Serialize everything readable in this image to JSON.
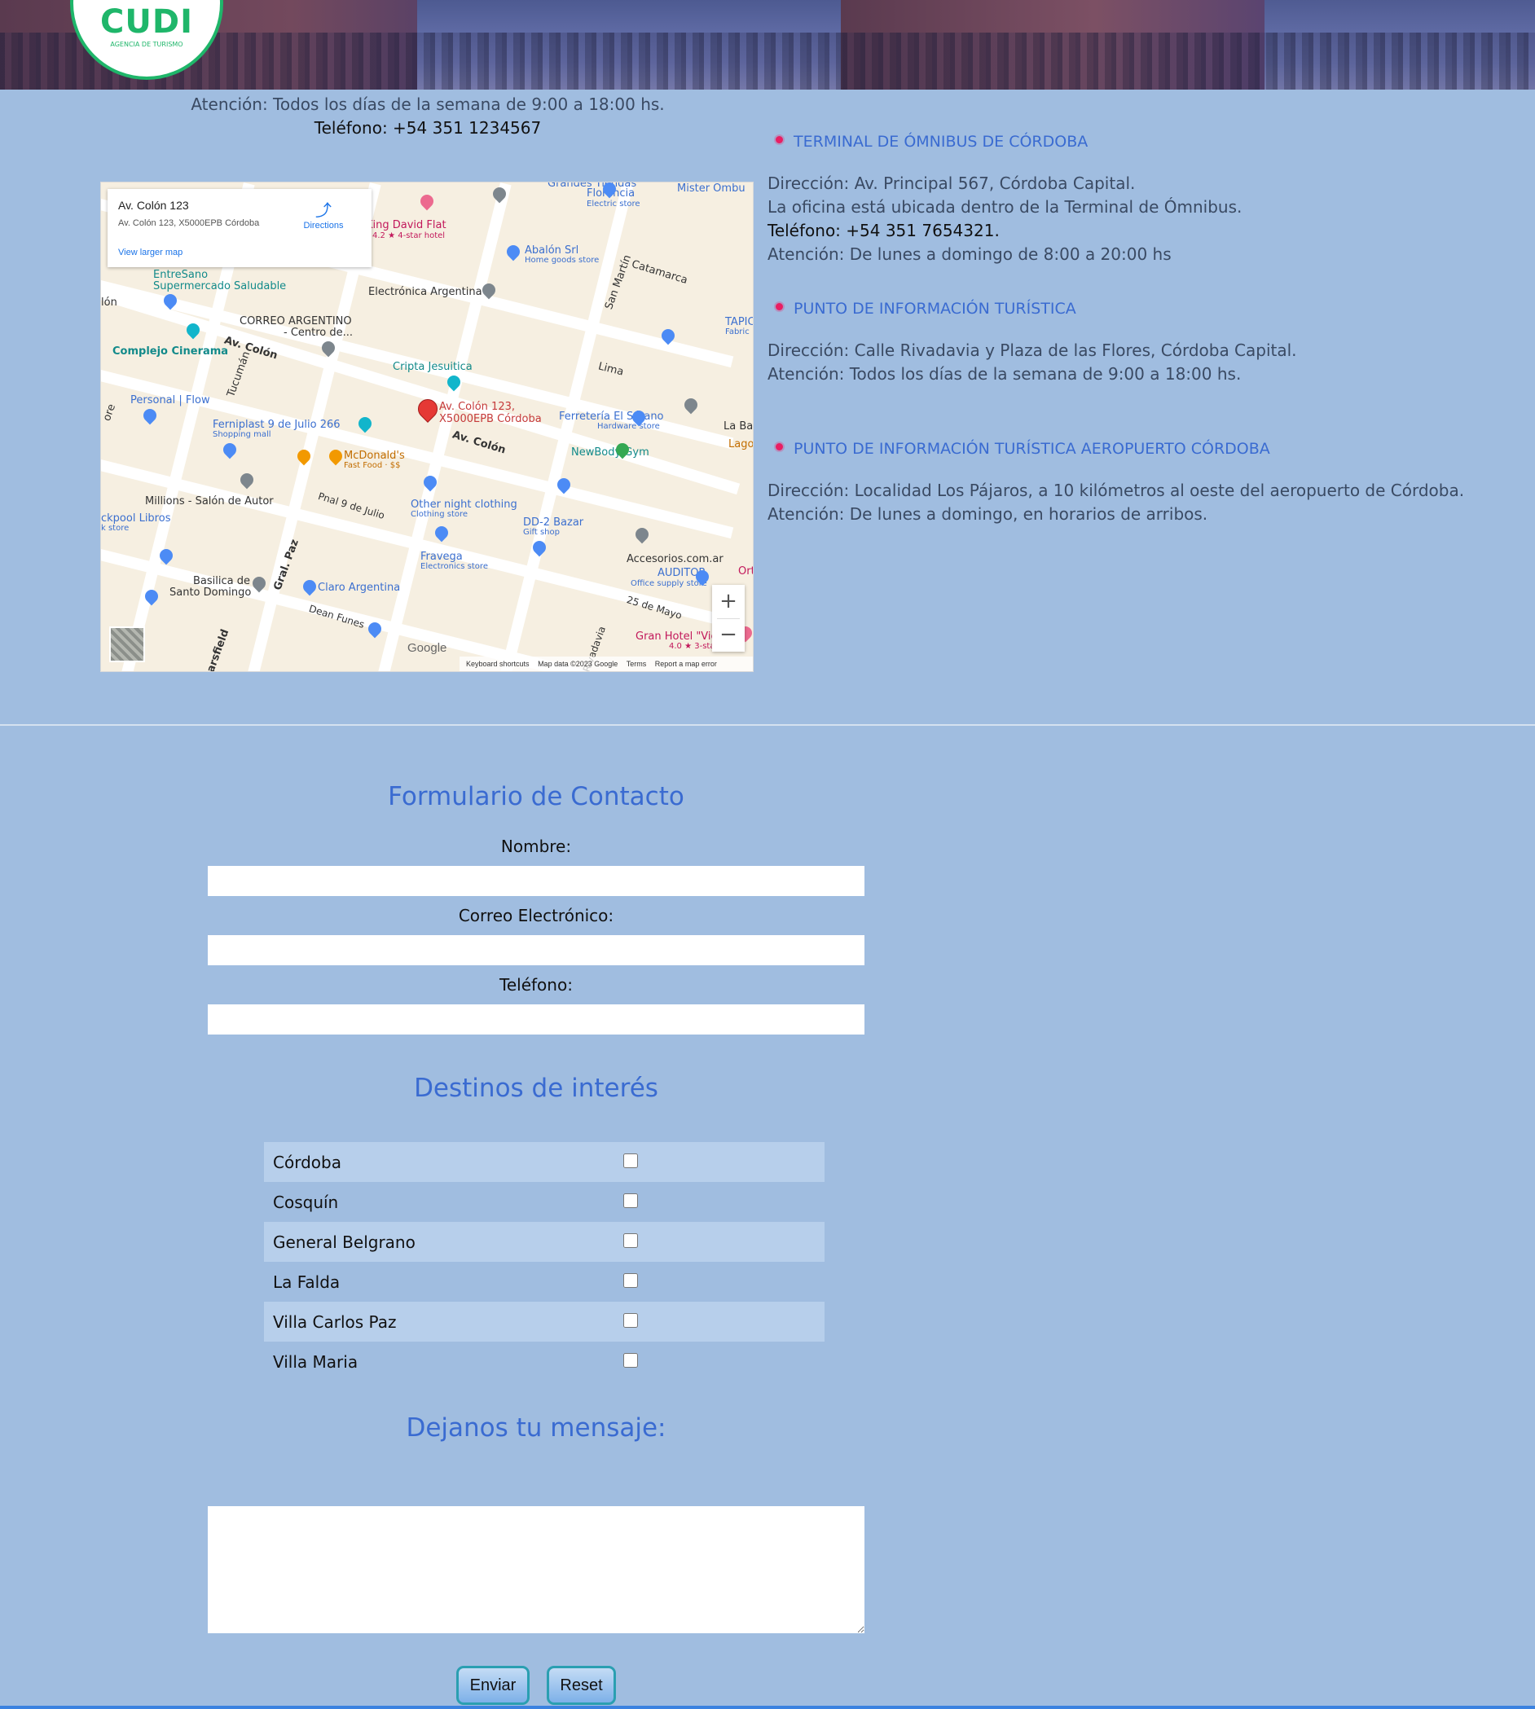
{
  "header": {
    "logo_text": "CUDI",
    "logo_subtext": "AGENCIA DE TURISMO"
  },
  "main_office": {
    "atencion": "Atención: Todos los días de la semana de 9:00 a 18:00 hs.",
    "telefono": "Teléfono: +54 351 1234567"
  },
  "map": {
    "place_title": "Av. Colón 123",
    "place_address": "Av. Colón 123, X5000EPB Córdoba",
    "directions_label": "Directions",
    "larger_map_link": "View larger map",
    "pin_label_line1": "Av. Colón 123,",
    "pin_label_line2": "X5000EPB Córdoba",
    "zoom_in": "+",
    "zoom_out": "−",
    "google_logo": "Google",
    "footer": {
      "shortcuts": "Keyboard shortcuts",
      "map_data": "Map data ©2023 Google",
      "terms": "Terms",
      "report": "Report a map error"
    },
    "places": [
      "King David Flat",
      "4.2 ★ 4-star hotel",
      "Grandes Tiendas",
      "Florencia",
      "Electric store",
      "Mister Ombu",
      "EntreSano",
      "Supermercado Saludable",
      "Electrónica Argentina",
      "Abalón Srl",
      "Home goods store",
      "CORREO ARGENTINO",
      "- Centro de...",
      "Complejo Cinerama",
      "Av. Colón",
      "Cripta Jesuitica",
      "Lima",
      "Personal | Flow",
      "Ferniplast 9 de Julio 266",
      "Shopping mall",
      "Ferretería El Sótano",
      "Hardware store",
      "McDonald's",
      "Fast Food · $$",
      "NewBody Gym",
      "Millions - Salón de Autor",
      "Other night clothing",
      "Clothing store",
      "DD-2 Bazar",
      "Gift shop",
      "Basilica de",
      "Santo Domingo",
      "Fravega",
      "Electronics store",
      "Claro Argentina",
      "Accesorios.com.ar",
      "AUDITOR",
      "Office supply store",
      "Gran Hotel \"Vic",
      "4.0 ★ 3-sta",
      "Tucumán",
      "San Martín",
      "Catamarca",
      "Pnal 9 de Julio",
      "Gral. Paz",
      "Dean Funes",
      "Rivadavia",
      "25 de Mayo",
      "Sarsfield",
      "TAPIC",
      "Fabric",
      "La Barr",
      "Lago",
      "Ort",
      "ckpool Libros",
      "k store",
      "lón",
      "ore"
    ]
  },
  "offices": [
    {
      "title": "TERMINAL DE ÓMNIBUS DE CÓRDOBA",
      "direccion": "Dirección: Av. Principal 567, Córdoba Capital.",
      "nota": "La oficina está ubicada dentro de la Terminal de Ómnibus.",
      "telefono": "Teléfono: +54 351 7654321.",
      "atencion": "Atención: De lunes a domingo de 8:00 a 20:00 hs"
    },
    {
      "title": "PUNTO DE INFORMACIÓN TURÍSTICA",
      "direccion": "Dirección: Calle Rivadavia y Plaza de las Flores, Córdoba Capital.",
      "atencion": "Atención: Todos los días de la semana de 9:00 a 18:00 hs."
    },
    {
      "title": "PUNTO DE INFORMACIÓN TURÍSTICA AEROPUERTO CÓRDOBA",
      "direccion": "Dirección: Localidad Los Pájaros, a 10 kilómetros al oeste del aeropuerto de Córdoba.",
      "atencion": "Atención: De lunes a domingo, en horarios de arribos."
    }
  ],
  "form": {
    "title": "Formulario de Contacto",
    "nombre_label": "Nombre:",
    "correo_label": "Correo Electrónico:",
    "telefono_label": "Teléfono:",
    "nombre_value": "",
    "correo_value": "",
    "telefono_value": "",
    "destinos_title": "Destinos de interés",
    "destinos": [
      "Córdoba",
      "Cosquín",
      "General Belgrano",
      "La Falda",
      "Villa Carlos Paz",
      "Villa Maria"
    ],
    "mensaje_title": "Dejanos tu mensaje:",
    "mensaje_value": "",
    "enviar_label": "Enviar",
    "reset_label": "Reset"
  },
  "colors": {
    "page_background": "#a0bde0",
    "heading_blue": "#3a6bd1",
    "bullet_pink": "#e91e63",
    "logo_green": "#1fb66a",
    "button_border": "#2a9fb1"
  }
}
